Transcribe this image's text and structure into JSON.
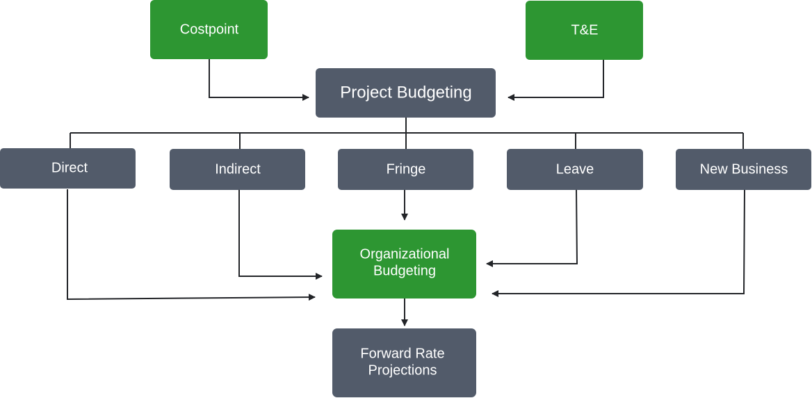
{
  "colors": {
    "green": "#2d9632",
    "slate": "#525b6a",
    "connector": "#222428"
  },
  "nodes": {
    "costpoint": "Costpoint",
    "te": "T&E",
    "project_budgeting": "Project Budgeting",
    "direct": "Direct",
    "indirect": "Indirect",
    "fringe": "Fringe",
    "leave": "Leave",
    "new_business": "New Business",
    "organizational_budgeting": [
      "Organizational",
      "Budgeting"
    ],
    "forward_rate_projections": [
      "Forward Rate",
      "Projections"
    ]
  }
}
